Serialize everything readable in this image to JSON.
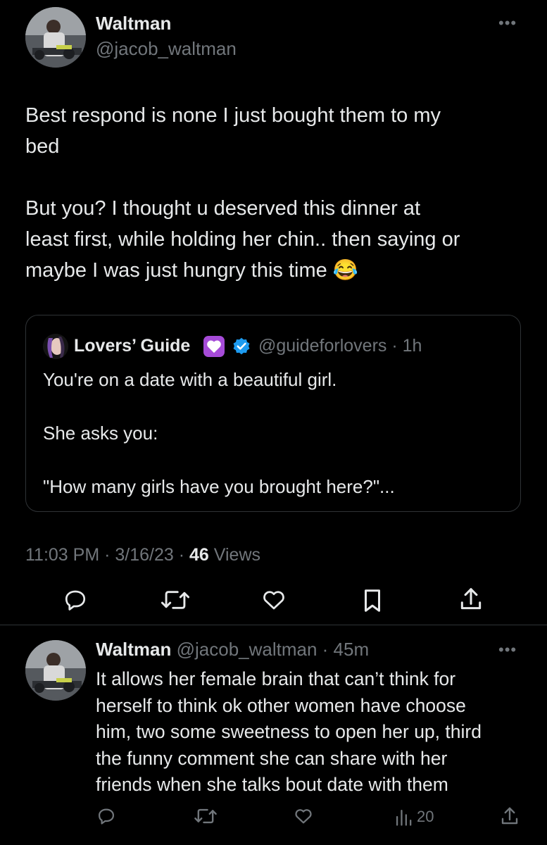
{
  "main_tweet": {
    "author_name": "Waltman",
    "author_handle": "@jacob_waltman",
    "more_icon": "more-horizontal-icon",
    "text_para1_line1": "Best respond is none I just bought them to my",
    "text_para1_line2": "bed",
    "text_para2_line1": "But you? I thought u deserved this dinner at",
    "text_para2_line2": "least first, while holding her chin.. then saying or",
    "text_para2_line3": "maybe I was just hungry this time",
    "emoji": "😂",
    "quote": {
      "author_name": "Lovers’ Guide",
      "author_emoji": "💟",
      "handle_time": "@guideforlovers · 1h",
      "line1": "You're on a date with a beautiful girl.",
      "line2": "She asks you:",
      "line3": "\"How many girls have you brought here?\"..."
    },
    "timestamp": "11:03 PM · 3/16/23 · ",
    "views_count": "46",
    "views_label": " Views",
    "actions": [
      "reply-icon",
      "retweet-icon",
      "like-icon",
      "bookmark-icon",
      "share-icon"
    ]
  },
  "reply_tweet": {
    "author_name": "Waltman",
    "handle_time": "@jacob_waltman · 45m",
    "lines": [
      "It allows her female brain that can’t think for",
      "herself to think ok other women have choose",
      "him, two some sweetness to open her up, third",
      "the funny comment she can share with her",
      "friends when she talks bout date with them"
    ],
    "views_count": "20"
  },
  "colors": {
    "background": "#000000",
    "text": "#e7e9ea",
    "muted": "#71767b",
    "border": "#2f3336",
    "verified": "#1d9bf0"
  }
}
